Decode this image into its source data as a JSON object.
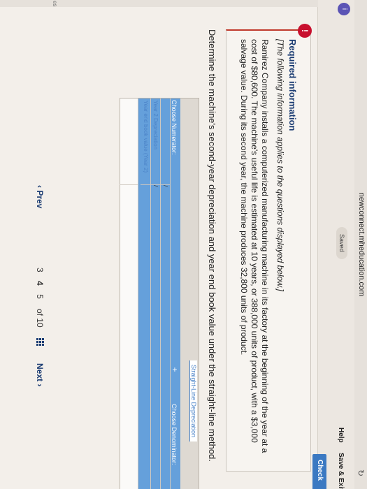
{
  "browser": {
    "url": "newconnect.mheducation.com"
  },
  "header": {
    "saved": "Saved",
    "help": "Help",
    "save_exit": "Save & Exit",
    "check": "Check"
  },
  "info": {
    "title": "Required information",
    "italic": "[The following information applies to the questions displayed below.]",
    "body": "Ramirez Company installs a computerized manufacturing machine in its factory at the beginning of the year at a cost of $80,600. The machine's useful life is estimated at 10 years, or 388,000 units of product, with a $3,000 salvage value. During its second year, the machine produces 32,800 units of product."
  },
  "question": "Determine the machine's second-year depreciation and year end book value under the straight-line method.",
  "worksheet": {
    "title": "Straight-Line Depreciation",
    "choose_numerator": "Choose Numerator:",
    "choose_denominator": "Choose Denominator:",
    "slash": "/",
    "rows": [
      "Year 2 Depreciation",
      "Year end book value (Year 2)"
    ],
    "left_label": "es"
  },
  "nav": {
    "prev": "‹ Prev",
    "pages": [
      "3",
      "4",
      "5"
    ],
    "current": "4",
    "of": "of 10",
    "next": "Next ›"
  }
}
